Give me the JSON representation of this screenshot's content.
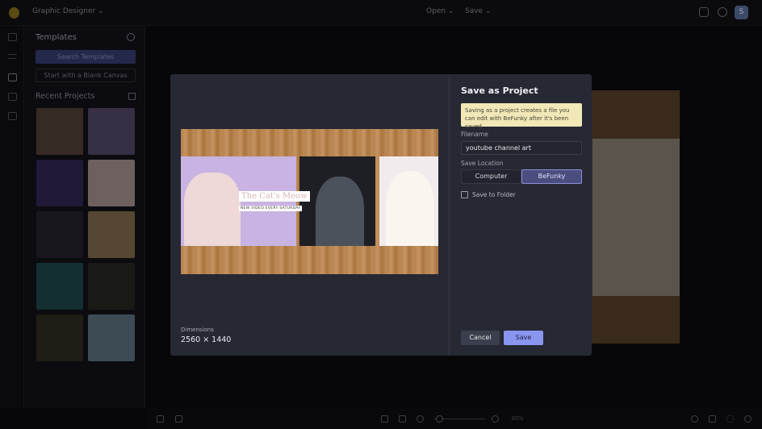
{
  "topbar": {
    "workspace": "Graphic Designer",
    "open": "Open",
    "save": "Save",
    "avatar": "S"
  },
  "sidebar": {
    "title": "Templates",
    "search_button": "Search Templates",
    "blank_button": "Start with a Blank Canvas",
    "recent_title": "Recent Projects",
    "thumbs": [
      "#6b5040",
      "#6a5a8a",
      "#3a2a6a",
      "#e6c8c0",
      "#2a2530",
      "#b0905a",
      "#1f5a5a",
      "#2a2a20",
      "#3a3020",
      "#7a9aa8"
    ]
  },
  "bottombar": {
    "zoom": "30%",
    "zoom_fraction": 0.05
  },
  "modal": {
    "title": "Save as Project",
    "note": "Saving as a project creates a file you can edit with BeFunky after it's been saved.",
    "filename_label": "Filename",
    "filename_value": "youtube channel art",
    "location_label": "Save Location",
    "locations": [
      "Computer",
      "BeFunky"
    ],
    "selected_location": "BeFunky",
    "save_to_folder": "Save to Folder",
    "save_to_folder_checked": false,
    "cancel": "Cancel",
    "save": "Save",
    "dimensions_label": "Dimensions",
    "dimensions_value": "2560 × 1440",
    "preview": {
      "title": "The Cat's Meow",
      "subtitle": "NEW VIDEO EVERY SATURDAY"
    }
  }
}
